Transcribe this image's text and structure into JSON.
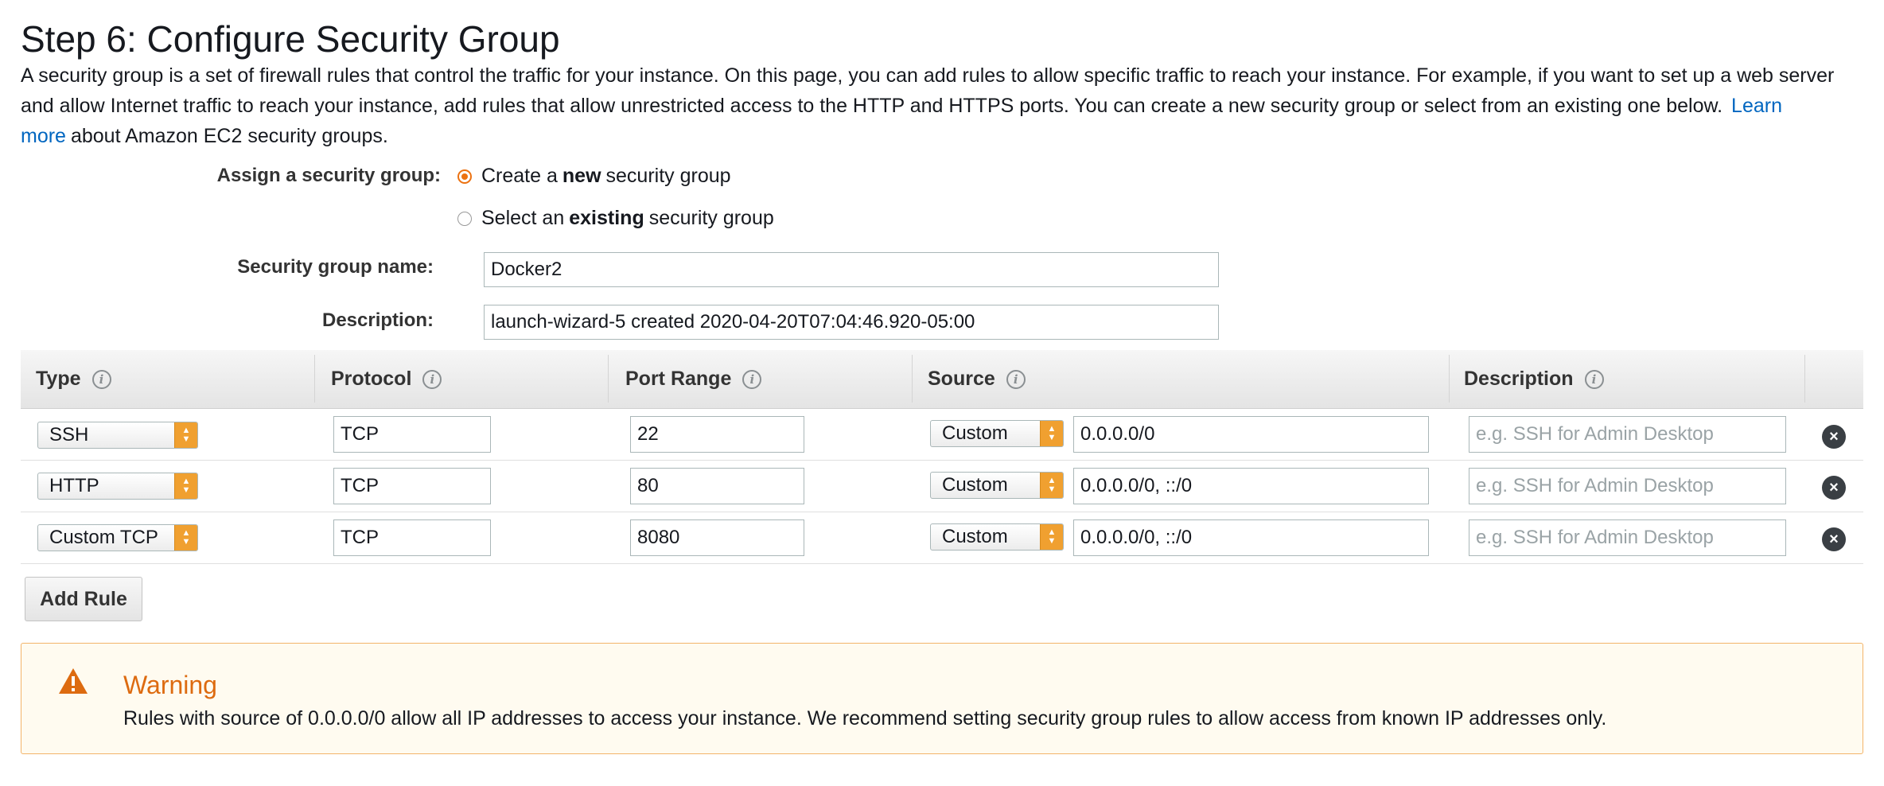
{
  "page": {
    "title": "Step 6: Configure Security Group",
    "intro_text": "A security group is a set of firewall rules that control the traffic for your instance. On this page, you can add rules to allow specific traffic to reach your instance. For example, if you want to set up a web server and allow Internet traffic to reach your instance, add rules that allow unrestricted access to the HTTP and HTTPS ports. You can create a new security group or select from an existing one below.",
    "learn_more_link": "Learn more",
    "intro_suffix": "about Amazon EC2 security groups."
  },
  "assign": {
    "label": "Assign a security group:",
    "options": [
      {
        "prefix": "Create a",
        "bold": "new",
        "suffix": "security group",
        "selected": true
      },
      {
        "prefix": "Select an",
        "bold": "existing",
        "suffix": "security group",
        "selected": false
      }
    ]
  },
  "group_name": {
    "label": "Security group name:",
    "value": "Docker2"
  },
  "description": {
    "label": "Description:",
    "value": "launch-wizard-5 created 2020-04-20T07:04:46.920-05:00"
  },
  "table": {
    "headers": [
      "Type",
      "Protocol",
      "Port Range",
      "Source",
      "Description"
    ],
    "rules": [
      {
        "type": "SSH",
        "protocol": "TCP",
        "port": "22",
        "source_type": "Custom",
        "source": "0.0.0.0/0",
        "description_placeholder": "e.g. SSH for Admin Desktop"
      },
      {
        "type": "HTTP",
        "protocol": "TCP",
        "port": "80",
        "source_type": "Custom",
        "source": "0.0.0.0/0, ::/0",
        "description_placeholder": "e.g. SSH for Admin Desktop"
      },
      {
        "type": "Custom TCP",
        "protocol": "TCP",
        "port": "8080",
        "source_type": "Custom",
        "source": "0.0.0.0/0, ::/0",
        "description_placeholder": "e.g. SSH for Admin Desktop"
      }
    ],
    "remove_icon": "close-circle-icon",
    "info_icon": "info-icon"
  },
  "add_rule_label": "Add Rule",
  "warning": {
    "icon": "warning-triangle-icon",
    "title": "Warning",
    "text": "Rules with source of 0.0.0.0/0 allow all IP addresses to access your instance. We recommend setting security group rules to allow access from known IP addresses only."
  },
  "colors": {
    "accent": "#ec7211",
    "link": "#0066c0",
    "warning_title": "#dd6b10",
    "warning_bg": "#fffbf0",
    "warning_border": "#f3b46a"
  }
}
